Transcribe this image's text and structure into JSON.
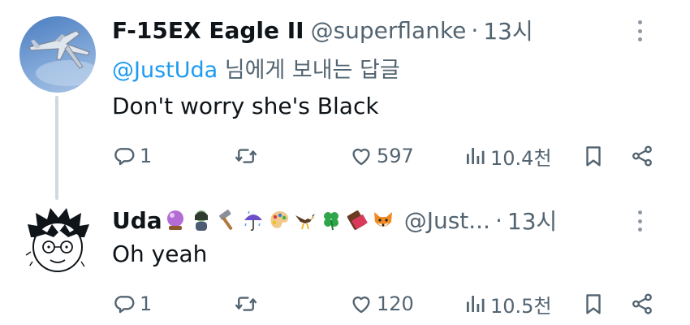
{
  "tweets": [
    {
      "author": {
        "name": "F-15EX Eagle II",
        "handle": "@superflanke",
        "avatar_icon": "fighter-jet-avatar"
      },
      "separator": "·",
      "time": "13시",
      "reply_to": {
        "mention": "@JustUda",
        "suffix": " 님에게 보내는 답글"
      },
      "text": "Don't worry she's Black",
      "stats": {
        "replies": "1",
        "retweets": "",
        "likes": "597",
        "views": "10.4천"
      }
    },
    {
      "author": {
        "name": "Uda",
        "emojis": [
          "crystal-ball",
          "woman-zombie",
          "hammer",
          "umbrella-rain",
          "artist-palette",
          "eagle",
          "four-leaf-clover",
          "chocolate-bar",
          "fox-face"
        ],
        "handle": "@Just...",
        "avatar_icon": "cartoon-face-avatar"
      },
      "separator": "·",
      "time": "13시",
      "text": "Oh yeah",
      "stats": {
        "replies": "1",
        "retweets": "",
        "likes": "120",
        "views": "10.5천"
      }
    }
  ],
  "colors": {
    "text": "#0f1419",
    "secondary": "#536471",
    "link": "#1d9bf0",
    "thread_line": "#cfd9de"
  }
}
